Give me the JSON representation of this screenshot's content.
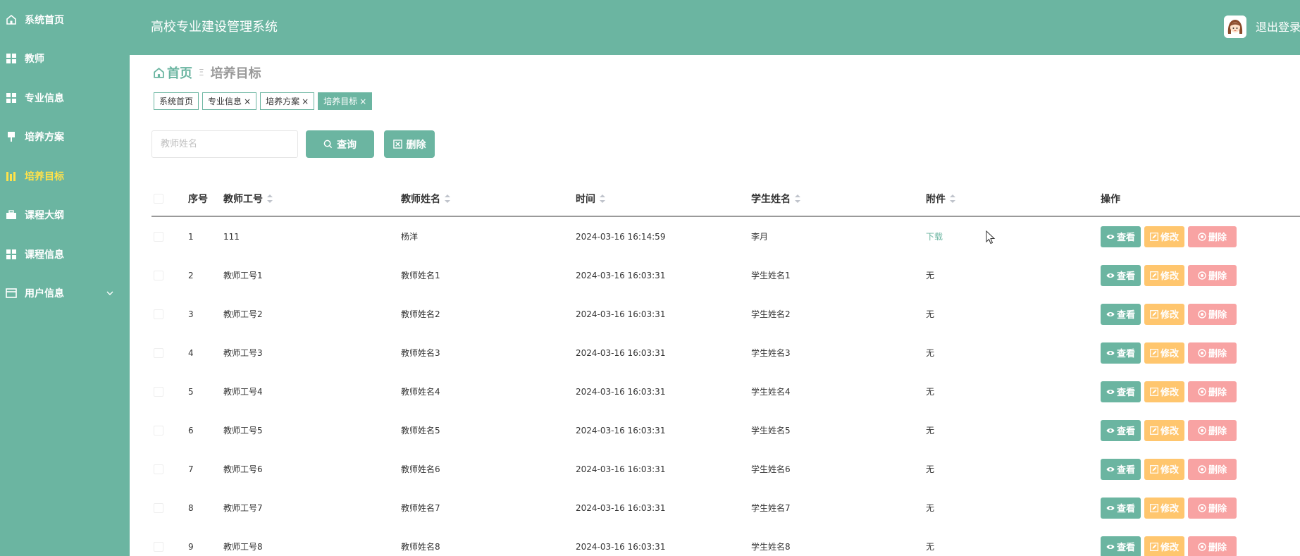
{
  "sidebar": {
    "items": [
      {
        "label": "系统首页",
        "icon": "home-icon"
      },
      {
        "label": "教师",
        "icon": "grid-icon"
      },
      {
        "label": "专业信息",
        "icon": "grid-icon"
      },
      {
        "label": "培养方案",
        "icon": "pushpin-icon"
      },
      {
        "label": "培养目标",
        "icon": "chart-icon",
        "active": true
      },
      {
        "label": "课程大纲",
        "icon": "briefcase-icon"
      },
      {
        "label": "课程信息",
        "icon": "grid-icon"
      },
      {
        "label": "用户信息",
        "icon": "window-icon",
        "expandable": true
      }
    ]
  },
  "header": {
    "title": "高校专业建设管理系统",
    "logout_label": "退出登录"
  },
  "breadcrumb": {
    "home": "首页",
    "separator": "Ξ",
    "current": "培养目标"
  },
  "tags": [
    {
      "label": "系统首页",
      "closable": false
    },
    {
      "label": "专业信息",
      "closable": true
    },
    {
      "label": "培养方案",
      "closable": true
    },
    {
      "label": "培养目标",
      "closable": true,
      "active": true
    }
  ],
  "tag_close_glyph": "×",
  "search": {
    "placeholder": "教师姓名",
    "value": "",
    "query_label": "查询",
    "delete_label": "删除"
  },
  "table": {
    "headers": {
      "no": "序号",
      "teacher_id": "教师工号",
      "teacher_name": "教师姓名",
      "time": "时间",
      "student_name": "学生姓名",
      "attachment": "附件",
      "actions": "操作"
    },
    "rows": [
      {
        "no": "1",
        "teacher_id": "111",
        "teacher_name": "杨洋",
        "time": "2024-03-16 16:14:59",
        "student_name": "李月",
        "attachment": "下载",
        "attachment_link": true
      },
      {
        "no": "2",
        "teacher_id": "教师工号1",
        "teacher_name": "教师姓名1",
        "time": "2024-03-16 16:03:31",
        "student_name": "学生姓名1",
        "attachment": "无"
      },
      {
        "no": "3",
        "teacher_id": "教师工号2",
        "teacher_name": "教师姓名2",
        "time": "2024-03-16 16:03:31",
        "student_name": "学生姓名2",
        "attachment": "无"
      },
      {
        "no": "4",
        "teacher_id": "教师工号3",
        "teacher_name": "教师姓名3",
        "time": "2024-03-16 16:03:31",
        "student_name": "学生姓名3",
        "attachment": "无"
      },
      {
        "no": "5",
        "teacher_id": "教师工号4",
        "teacher_name": "教师姓名4",
        "time": "2024-03-16 16:03:31",
        "student_name": "学生姓名4",
        "attachment": "无"
      },
      {
        "no": "6",
        "teacher_id": "教师工号5",
        "teacher_name": "教师姓名5",
        "time": "2024-03-16 16:03:31",
        "student_name": "学生姓名5",
        "attachment": "无"
      },
      {
        "no": "7",
        "teacher_id": "教师工号6",
        "teacher_name": "教师姓名6",
        "time": "2024-03-16 16:03:31",
        "student_name": "学生姓名6",
        "attachment": "无"
      },
      {
        "no": "8",
        "teacher_id": "教师工号7",
        "teacher_name": "教师姓名7",
        "time": "2024-03-16 16:03:31",
        "student_name": "学生姓名7",
        "attachment": "无"
      },
      {
        "no": "9",
        "teacher_id": "教师工号8",
        "teacher_name": "教师姓名8",
        "time": "2024-03-16 16:03:31",
        "student_name": "学生姓名8",
        "attachment": "无"
      }
    ],
    "actions": {
      "view": "查看",
      "edit": "修改",
      "delete": "删除"
    }
  },
  "colors": {
    "primary": "#6bb5a1",
    "sidebar_active_text": "#ffe24a",
    "edit": "#ffc66e",
    "delete": "#f8a3a3"
  }
}
